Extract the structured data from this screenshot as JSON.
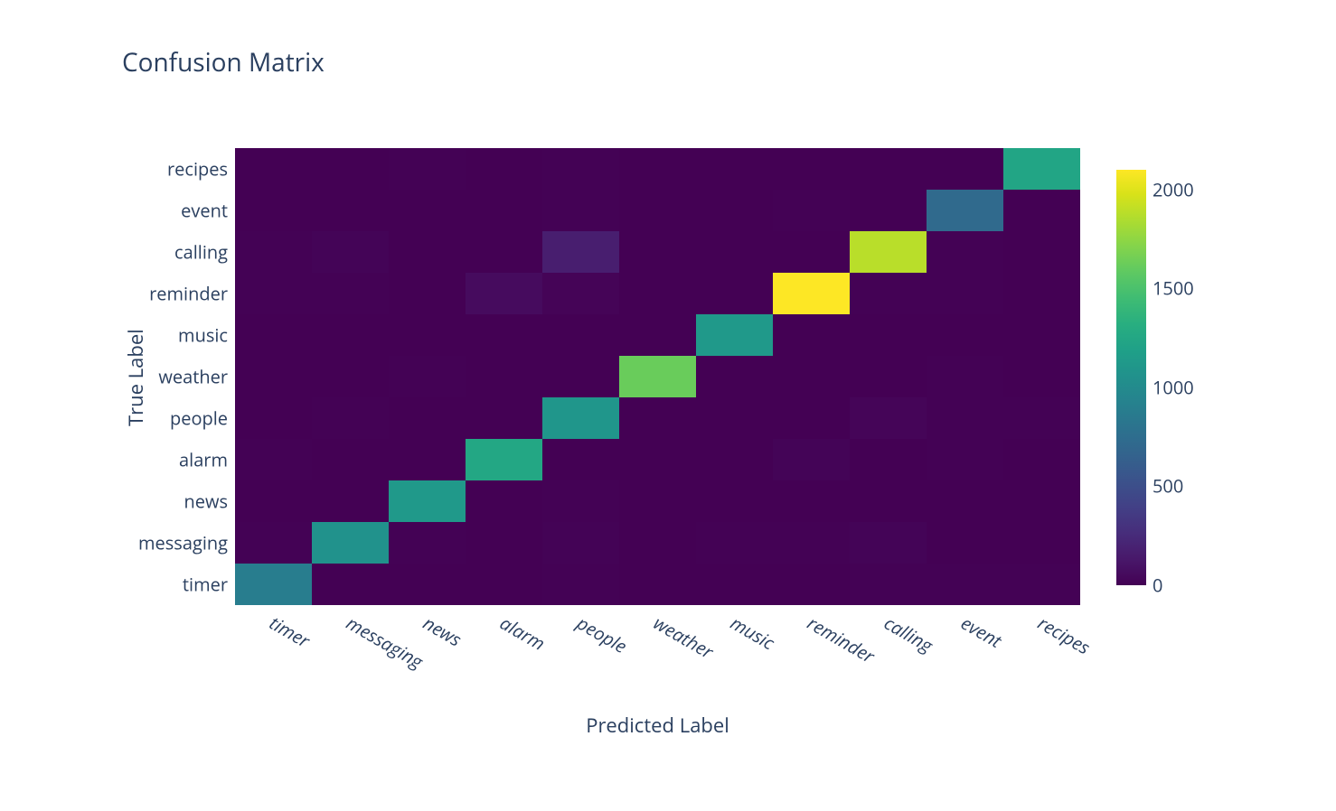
{
  "chart_data": {
    "type": "heatmap",
    "title": "Confusion Matrix",
    "xlabel": "Predicted Label",
    "ylabel": "True Label",
    "x_categories": [
      "timer",
      "messaging",
      "news",
      "alarm",
      "people",
      "weather",
      "music",
      "reminder",
      "calling",
      "event",
      "recipes"
    ],
    "y_categories_bottom_to_top": [
      "timer",
      "messaging",
      "news",
      "alarm",
      "people",
      "weather",
      "music",
      "reminder",
      "calling",
      "event",
      "recipes"
    ],
    "z": [
      [
        880,
        2,
        2,
        1,
        3,
        0,
        0,
        2,
        3,
        4,
        3
      ],
      [
        6,
        1060,
        5,
        0,
        12,
        0,
        3,
        6,
        15,
        0,
        0
      ],
      [
        2,
        1,
        1120,
        0,
        3,
        1,
        0,
        2,
        0,
        2,
        2
      ],
      [
        4,
        0,
        0,
        1250,
        0,
        0,
        1,
        15,
        0,
        6,
        0
      ],
      [
        2,
        8,
        2,
        0,
        1100,
        0,
        1,
        0,
        22,
        3,
        6
      ],
      [
        1,
        0,
        4,
        0,
        0,
        1620,
        0,
        2,
        0,
        3,
        0
      ],
      [
        2,
        0,
        0,
        0,
        0,
        0,
        1120,
        0,
        2,
        2,
        0
      ],
      [
        5,
        3,
        0,
        60,
        20,
        0,
        0,
        2100,
        4,
        8,
        0
      ],
      [
        5,
        15,
        0,
        0,
        170,
        0,
        2,
        2,
        1880,
        4,
        0
      ],
      [
        1,
        0,
        2,
        0,
        4,
        0,
        2,
        4,
        0,
        720,
        1
      ],
      [
        1,
        0,
        3,
        0,
        6,
        0,
        0,
        0,
        0,
        0,
        1230
      ]
    ],
    "zmin": 0,
    "zmax": 2100,
    "colorscale": "viridis",
    "colorbar_ticks": [
      0,
      500,
      1000,
      1500,
      2000
    ]
  },
  "colors": {
    "viridis_stops": [
      [
        0.0,
        "#440154"
      ],
      [
        0.06274509803921569,
        "#48186a"
      ],
      [
        0.12549019607843137,
        "#472d7b"
      ],
      [
        0.18823529411764706,
        "#424086"
      ],
      [
        0.25098039215686274,
        "#3b528b"
      ],
      [
        0.3137254901960784,
        "#33638d"
      ],
      [
        0.3764705882352941,
        "#2c728e"
      ],
      [
        0.4392156862745098,
        "#26828e"
      ],
      [
        0.5019607843137255,
        "#21918c"
      ],
      [
        0.5647058823529412,
        "#1fa088"
      ],
      [
        0.6274509803921569,
        "#28ae80"
      ],
      [
        0.6901960784313725,
        "#3fbc73"
      ],
      [
        0.7529411764705882,
        "#5ec962"
      ],
      [
        0.8156862745098039,
        "#84d44b"
      ],
      [
        0.8784313725490196,
        "#addc30"
      ],
      [
        0.9411764705882353,
        "#d8e219"
      ],
      [
        1.0,
        "#fde725"
      ]
    ]
  }
}
